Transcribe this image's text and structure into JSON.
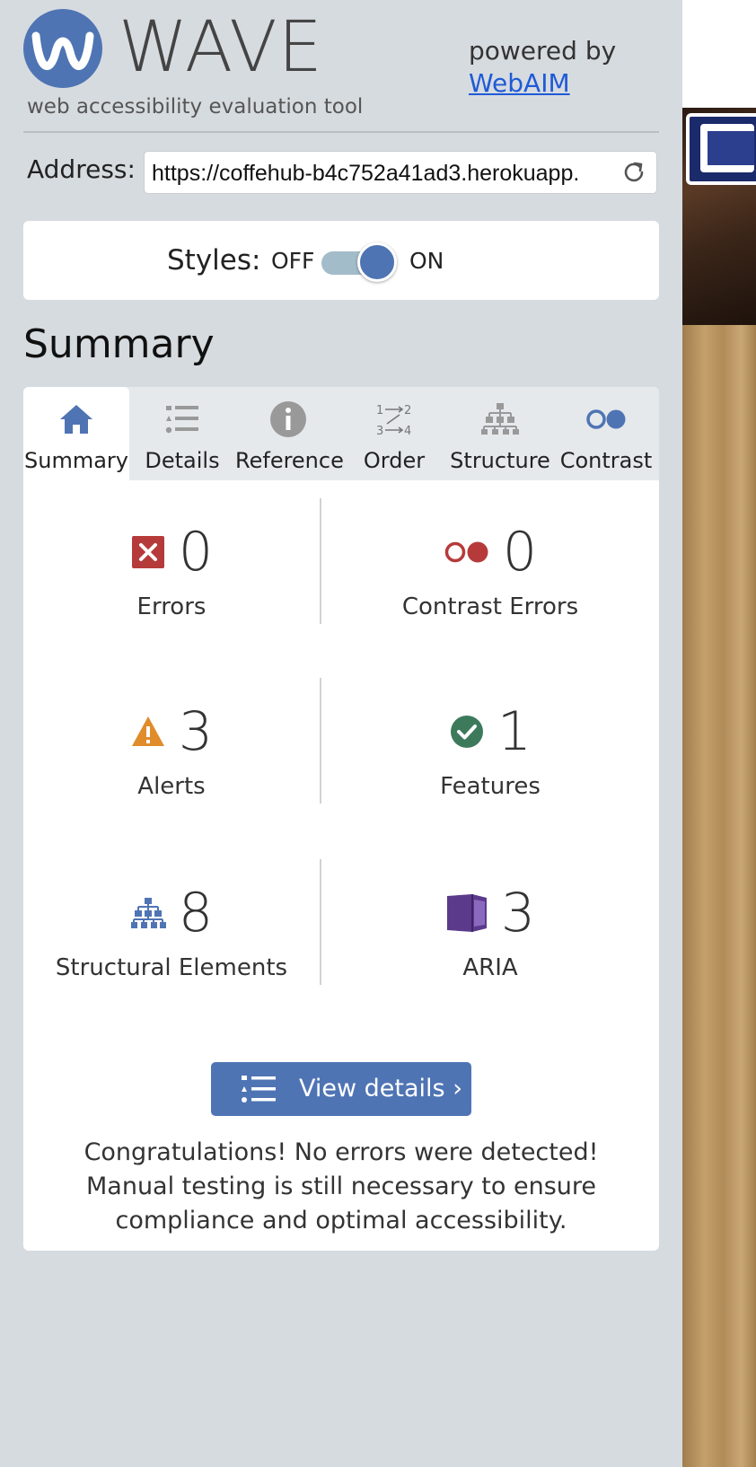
{
  "header": {
    "logo_text": "WAVE",
    "subtitle": "web accessibility evaluation tool",
    "powered_by": "powered by",
    "webaim_link": "WebAIM"
  },
  "address": {
    "label": "Address:",
    "value": "https://coffehub-b4c752a41ad3.herokuapp."
  },
  "styles": {
    "label": "Styles:",
    "off": "OFF",
    "on": "ON",
    "state": "on"
  },
  "summary_heading": "Summary",
  "tabs": [
    {
      "label": "Summary",
      "icon": "home-icon",
      "active": true
    },
    {
      "label": "Details",
      "icon": "list-icon",
      "active": false
    },
    {
      "label": "Reference",
      "icon": "info-icon",
      "active": false
    },
    {
      "label": "Order",
      "icon": "order-icon",
      "active": false
    },
    {
      "label": "Structure",
      "icon": "structure-icon",
      "active": false
    },
    {
      "label": "Contrast",
      "icon": "contrast-icon",
      "active": false
    }
  ],
  "stats": {
    "errors": {
      "count": "0",
      "label": "Errors",
      "icon": "error-icon"
    },
    "contrast_errors": {
      "count": "0",
      "label": "Contrast Errors",
      "icon": "contrast-error-icon"
    },
    "alerts": {
      "count": "3",
      "label": "Alerts",
      "icon": "alert-icon"
    },
    "features": {
      "count": "1",
      "label": "Features",
      "icon": "feature-icon"
    },
    "structural": {
      "count": "8",
      "label": "Structural Elements",
      "icon": "structure-icon"
    },
    "aria": {
      "count": "3",
      "label": "ARIA",
      "icon": "aria-icon"
    }
  },
  "view_details": "View details ›",
  "message": "Congratulations! No errors were detected! Manual testing is still necessary to ensure compliance and optimal accessibility.",
  "colors": {
    "accent": "#4f74b4",
    "error": "#b63a3a",
    "alert": "#e08c2b",
    "feature": "#3d7a5c",
    "aria": "#5b3a8c",
    "background": "#d6dbe0"
  }
}
